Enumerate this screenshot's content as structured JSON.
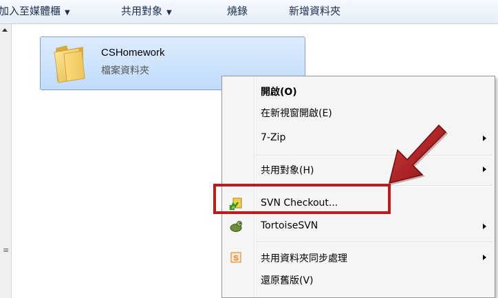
{
  "toolbar": {
    "items": [
      {
        "label": "加入至媒體櫃",
        "dropdown": true
      },
      {
        "label": "共用對象",
        "dropdown": true
      },
      {
        "label": "燒錄",
        "dropdown": false
      },
      {
        "label": "新增資料夾",
        "dropdown": false
      }
    ]
  },
  "folder": {
    "name": "CSHomework",
    "type": "檔案資料夾"
  },
  "context_menu": {
    "items": [
      {
        "label": "開啟(O)",
        "bold": true
      },
      {
        "label": "在新視窗開啟(E)"
      },
      {
        "label": "7-Zip",
        "submenu": true
      },
      {
        "label": "共用對象(H)",
        "submenu": true
      },
      {
        "label": "SVN Checkout...",
        "icon": "svn-checkout-icon"
      },
      {
        "label": "TortoiseSVN",
        "icon": "tortoisesvn-icon",
        "submenu": true
      },
      {
        "label": "共用資料夾同步處理",
        "icon": "sync-share-icon",
        "submenu": true
      },
      {
        "label": "還原舊版(V)"
      }
    ]
  },
  "colors": {
    "highlight": "#c0181b",
    "arrow": "#b51f22",
    "selection": "#c1dcfc"
  }
}
